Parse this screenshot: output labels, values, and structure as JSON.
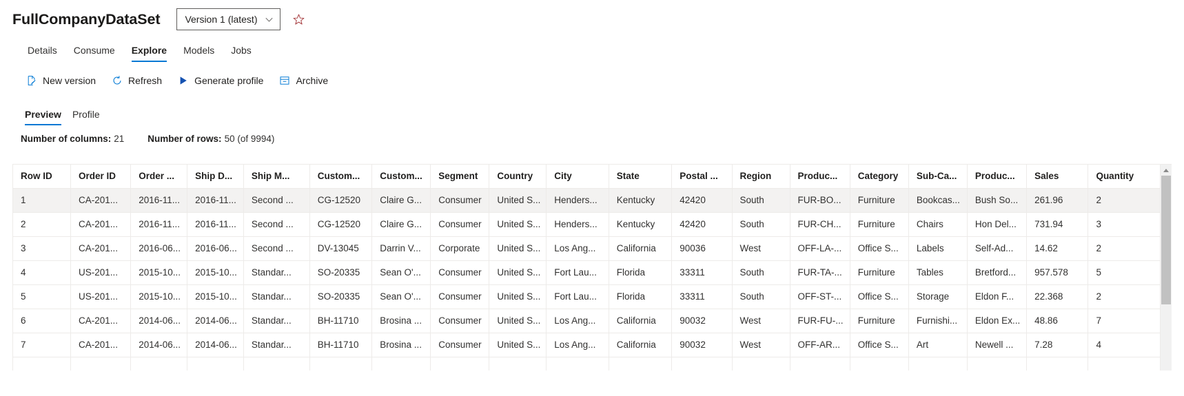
{
  "header": {
    "title": "FullCompanyDataSet",
    "version_label": "Version 1 (latest)",
    "favorite_icon": "star-icon",
    "chevron_icon": "chevron-down-icon"
  },
  "pivot": {
    "items": [
      {
        "label": "Details",
        "selected": false
      },
      {
        "label": "Consume",
        "selected": false
      },
      {
        "label": "Explore",
        "selected": true
      },
      {
        "label": "Models",
        "selected": false
      },
      {
        "label": "Jobs",
        "selected": false
      }
    ]
  },
  "commandbar": {
    "items": [
      {
        "label": "New version",
        "icon": "page-edit-icon"
      },
      {
        "label": "Refresh",
        "icon": "refresh-icon"
      },
      {
        "label": "Generate profile",
        "icon": "play-icon"
      },
      {
        "label": "Archive",
        "icon": "archive-icon"
      }
    ]
  },
  "subpivot": {
    "items": [
      {
        "label": "Preview",
        "selected": true
      },
      {
        "label": "Profile",
        "selected": false
      }
    ]
  },
  "counts": {
    "columns_label": "Number of columns:",
    "columns_value": "21",
    "rows_label": "Number of rows:",
    "rows_value": "50 (of 9994)"
  },
  "grid": {
    "columns": [
      "Row ID",
      "Order ID",
      "Order ...",
      "Ship D...",
      "Ship M...",
      "Custom...",
      "Custom...",
      "Segment",
      "Country",
      "City",
      "State",
      "Postal ...",
      "Region",
      "Produc...",
      "Category",
      "Sub-Ca...",
      "Produc...",
      "Sales",
      "Quantity"
    ],
    "rows": [
      [
        "1",
        "CA-201...",
        "2016-11...",
        "2016-11...",
        "Second ...",
        "CG-12520",
        "Claire G...",
        "Consumer",
        "United S...",
        "Henders...",
        "Kentucky",
        "42420",
        "South",
        "FUR-BO...",
        "Furniture",
        "Bookcas...",
        "Bush So...",
        "261.96",
        "2"
      ],
      [
        "2",
        "CA-201...",
        "2016-11...",
        "2016-11...",
        "Second ...",
        "CG-12520",
        "Claire G...",
        "Consumer",
        "United S...",
        "Henders...",
        "Kentucky",
        "42420",
        "South",
        "FUR-CH...",
        "Furniture",
        "Chairs",
        "Hon Del...",
        "731.94",
        "3"
      ],
      [
        "3",
        "CA-201...",
        "2016-06...",
        "2016-06...",
        "Second ...",
        "DV-13045",
        "Darrin V...",
        "Corporate",
        "United S...",
        "Los Ang...",
        "California",
        "90036",
        "West",
        "OFF-LA-...",
        "Office S...",
        "Labels",
        "Self-Ad...",
        "14.62",
        "2"
      ],
      [
        "4",
        "US-201...",
        "2015-10...",
        "2015-10...",
        "Standar...",
        "SO-20335",
        "Sean O'...",
        "Consumer",
        "United S...",
        "Fort Lau...",
        "Florida",
        "33311",
        "South",
        "FUR-TA-...",
        "Furniture",
        "Tables",
        "Bretford...",
        "957.578",
        "5"
      ],
      [
        "5",
        "US-201...",
        "2015-10...",
        "2015-10...",
        "Standar...",
        "SO-20335",
        "Sean O'...",
        "Consumer",
        "United S...",
        "Fort Lau...",
        "Florida",
        "33311",
        "South",
        "OFF-ST-...",
        "Office S...",
        "Storage",
        "Eldon F...",
        "22.368",
        "2"
      ],
      [
        "6",
        "CA-201...",
        "2014-06...",
        "2014-06...",
        "Standar...",
        "BH-11710",
        "Brosina ...",
        "Consumer",
        "United S...",
        "Los Ang...",
        "California",
        "90032",
        "West",
        "FUR-FU-...",
        "Furniture",
        "Furnishi...",
        "Eldon Ex...",
        "48.86",
        "7"
      ],
      [
        "7",
        "CA-201...",
        "2014-06...",
        "2014-06...",
        "Standar...",
        "BH-11710",
        "Brosina ...",
        "Consumer",
        "United S...",
        "Los Ang...",
        "California",
        "90032",
        "West",
        "OFF-AR...",
        "Office S...",
        "Art",
        "Newell ...",
        "7.28",
        "4"
      ],
      [
        "",
        "",
        "",
        "",
        "",
        "",
        "",
        "",
        "",
        "",
        "",
        "",
        "",
        "",
        "",
        "",
        "",
        "",
        ""
      ]
    ],
    "hover_row_index": 0
  },
  "scrollbar": {
    "up_arrow_icon": "triangle-up-icon",
    "thumb": "scrollbar-thumb"
  },
  "colors": {
    "accent": "#0078d4",
    "border": "#edebe9",
    "hover_row": "#f3f2f1",
    "scroll_track": "#f1f1f1",
    "scroll_thumb": "#c1c1c1"
  }
}
